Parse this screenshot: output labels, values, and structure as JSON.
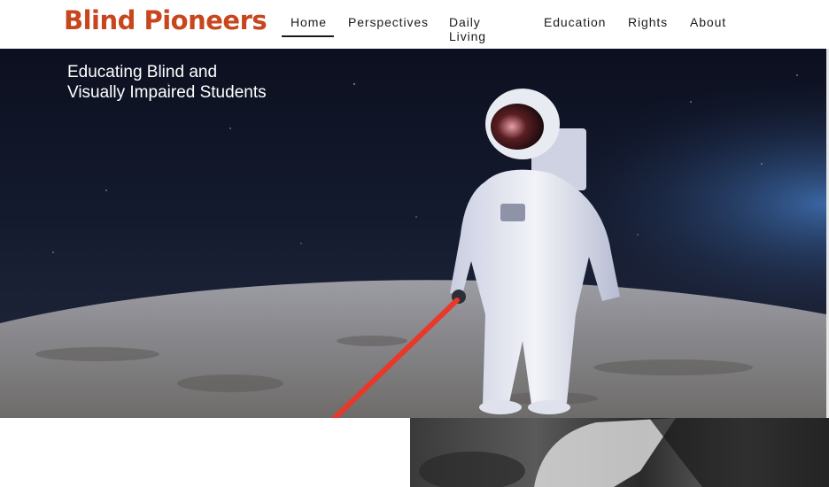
{
  "site": {
    "logo": "Blind Pioneers",
    "brand_color": "#c8461e"
  },
  "nav": {
    "items": [
      {
        "label": "Home",
        "active": true
      },
      {
        "label": "Perspectives",
        "active": false
      },
      {
        "label": "Daily Living",
        "active": false
      },
      {
        "label": "Education",
        "active": false
      },
      {
        "label": "Rights",
        "active": false
      },
      {
        "label": "About",
        "active": false
      }
    ]
  },
  "hero": {
    "title_line1": "Educating Blind and",
    "title_line2": "Visually Impaired Students",
    "cane_color": "#e8382a"
  }
}
